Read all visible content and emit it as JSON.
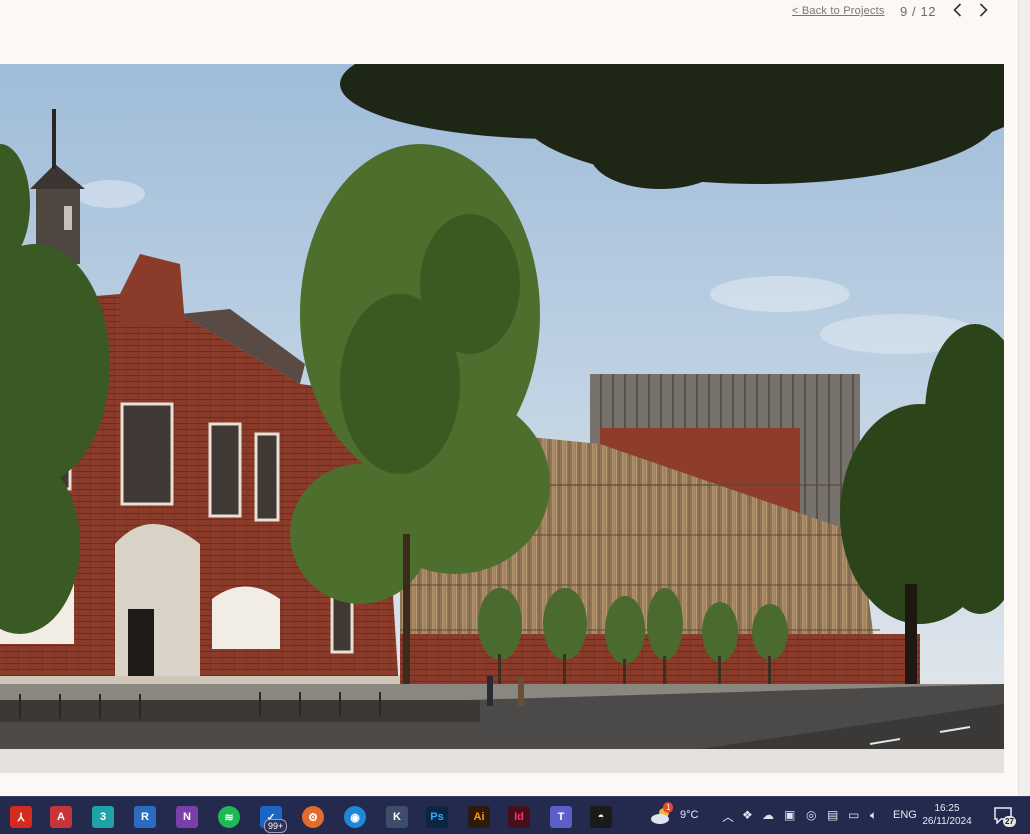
{
  "nav": {
    "back_label": "< Back to Projects",
    "counter": "9 / 12"
  },
  "icons": {
    "prev": "chevron-left-icon",
    "next": "chevron-right-icon"
  },
  "photo": {
    "subject": "project-photograph"
  },
  "taskbar": {
    "apps": [
      {
        "name": "acrobat-icon",
        "glyph": "⅄",
        "color": "#d42b1e"
      },
      {
        "name": "access-icon",
        "glyph": "A",
        "color": "#c5353b"
      },
      {
        "name": "3ds-max-icon",
        "glyph": "3",
        "color": "#1fa3a8"
      },
      {
        "name": "revit-icon",
        "glyph": "R",
        "color": "#2b6cc0"
      },
      {
        "name": "onenote-icon",
        "glyph": "N",
        "color": "#7b3fa8"
      },
      {
        "name": "spotify-icon",
        "glyph": "≋",
        "color": "#1db954"
      },
      {
        "name": "outlook-icon",
        "glyph": "✓",
        "color": "#1b66c4"
      },
      {
        "name": "app-orange-icon",
        "glyph": "⚙",
        "color": "#e36b2b"
      },
      {
        "name": "app-blue-circle-icon",
        "glyph": "◉",
        "color": "#1e88d8"
      },
      {
        "name": "app-k-icon",
        "glyph": "K",
        "color": "#3c4c6a"
      },
      {
        "name": "photoshop-icon",
        "glyph": "Ps",
        "color": "#0b2641"
      },
      {
        "name": "illustrator-icon",
        "glyph": "Ai",
        "color": "#2d1a0a"
      },
      {
        "name": "indesign-icon",
        "glyph": "Id",
        "color": "#45101b"
      },
      {
        "name": "teams-icon",
        "glyph": "T",
        "color": "#5b5fc7"
      },
      {
        "name": "app-dark-icon",
        "glyph": "◓",
        "color": "#1a1a1a"
      }
    ],
    "outlook_badge": "99+",
    "weather_badge": "1",
    "temperature": "9°C",
    "language": "ENG",
    "time": "16:25",
    "date": "26/11/2024",
    "notification_count": "27"
  },
  "colors": {
    "page_bg": "#fcf8f5",
    "taskbar_bg": "#232a4e",
    "link_color": "#7a7570"
  }
}
